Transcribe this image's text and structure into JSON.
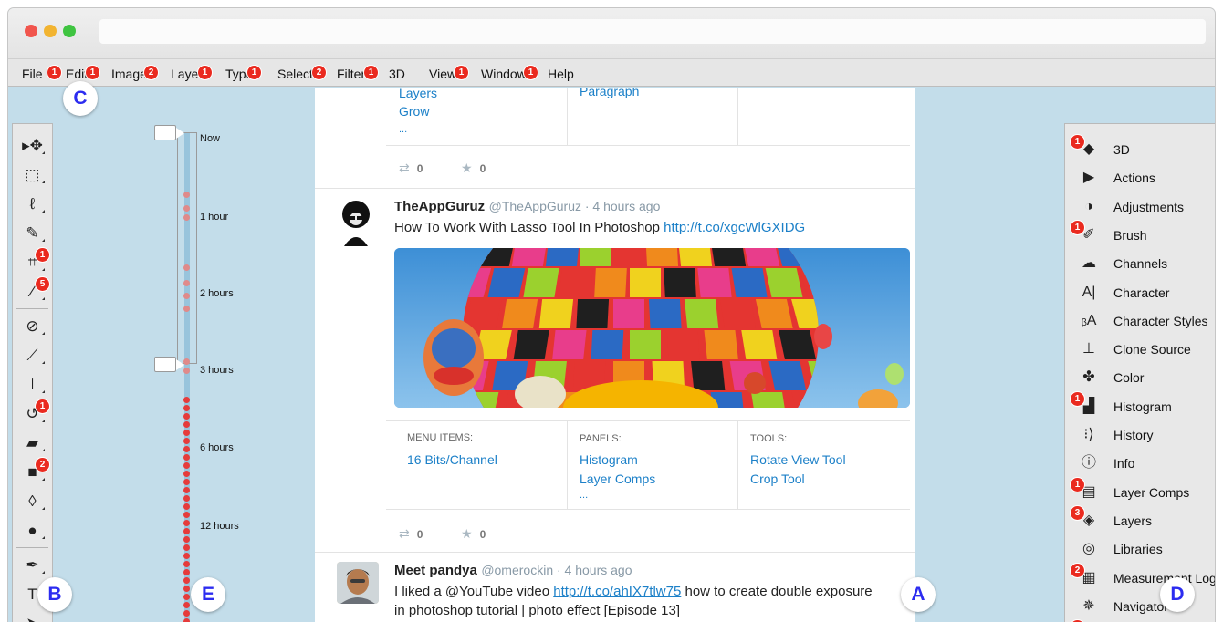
{
  "menubar": {
    "items": [
      {
        "label": "File",
        "badge": "1"
      },
      {
        "label": "Edit",
        "badge": "1"
      },
      {
        "label": "Image",
        "badge": "2"
      },
      {
        "label": "Layer",
        "badge": "1"
      },
      {
        "label": "Type",
        "badge": "1"
      },
      {
        "label": "Select",
        "badge": "2"
      },
      {
        "label": "Filter",
        "badge": "1"
      },
      {
        "label": "3D",
        "badge": ""
      },
      {
        "label": "View",
        "badge": "1"
      },
      {
        "label": "Window",
        "badge": "1"
      },
      {
        "label": "Help",
        "badge": ""
      }
    ]
  },
  "callouts": {
    "a": "A",
    "b": "B",
    "c": "C",
    "d": "D",
    "e": "E"
  },
  "toolbox": {
    "tools": [
      {
        "icon": "move-icon",
        "glyph": "▸✥",
        "badge": ""
      },
      {
        "icon": "marquee-icon",
        "glyph": "⬚",
        "badge": ""
      },
      {
        "icon": "lasso-icon",
        "glyph": "ℓ",
        "badge": ""
      },
      {
        "icon": "quick-select-icon",
        "glyph": "✎",
        "badge": ""
      },
      {
        "icon": "crop-icon",
        "glyph": "⌗",
        "badge": "1"
      },
      {
        "icon": "eyedropper-icon",
        "glyph": "⁄",
        "badge": "5"
      },
      {
        "icon": "healing-brush-icon",
        "glyph": "⊘",
        "badge": ""
      },
      {
        "icon": "brush-icon",
        "glyph": "⟋",
        "badge": ""
      },
      {
        "icon": "stamp-icon",
        "glyph": "⊥",
        "badge": ""
      },
      {
        "icon": "history-brush-icon",
        "glyph": "↺",
        "badge": "1"
      },
      {
        "icon": "eraser-icon",
        "glyph": "▰",
        "badge": ""
      },
      {
        "icon": "gradient-icon",
        "glyph": "■",
        "badge": "2"
      },
      {
        "icon": "blur-icon",
        "glyph": "◊",
        "badge": ""
      },
      {
        "icon": "dodge-icon",
        "glyph": "●",
        "badge": ""
      },
      {
        "icon": "pen-icon",
        "glyph": "✒",
        "badge": ""
      },
      {
        "icon": "type-icon",
        "glyph": "T",
        "badge": ""
      },
      {
        "icon": "path-select-icon",
        "glyph": "➤",
        "badge": ""
      }
    ]
  },
  "timeline": {
    "labels": [
      "Now",
      "1 hour",
      "2 hours",
      "3 hours",
      "6 hours",
      "12 hours"
    ]
  },
  "feed": {
    "top_card": {
      "col1_links": [
        "Layers",
        "Grow",
        "..."
      ],
      "col2_links": [
        "Paragraph"
      ],
      "retweets": "0",
      "favorites": "0"
    },
    "tweet1": {
      "name": "TheAppGuruz",
      "handle_time": "@TheAppGuruz · 4 hours ago",
      "text": "How To Work With Lasso Tool In Photoshop ",
      "link": "http://t.co/xgcWlGXIDG",
      "columns": [
        {
          "header": "MENU ITEMS:",
          "links": [
            "16 Bits/Channel"
          ]
        },
        {
          "header": "PANELS:",
          "links": [
            "Histogram",
            "Layer Comps",
            "..."
          ]
        },
        {
          "header": "TOOLS:",
          "links": [
            "Rotate View Tool",
            "Crop Tool"
          ]
        }
      ],
      "retweets": "0",
      "favorites": "0"
    },
    "tweet2": {
      "name": "Meet pandya",
      "handle_time": "@omerockin · 4 hours ago",
      "text_before": "I liked a @YouTube video ",
      "link": "http://t.co/ahIX7tlw75",
      "text_after_line1": " how to create double exposure",
      "text_line2": "in photoshop tutorial | photo effect [Episode 13]"
    }
  },
  "panels": {
    "items": [
      {
        "label": "3D",
        "icon": "cube-icon",
        "glyph": "◆",
        "badge": "1"
      },
      {
        "label": "Actions",
        "icon": "play-icon",
        "glyph": "▶",
        "badge": ""
      },
      {
        "label": "Adjustments",
        "icon": "adjustments-icon",
        "glyph": "◑",
        "badge": ""
      },
      {
        "label": "Brush",
        "icon": "brush-icon",
        "glyph": "✐",
        "badge": "1"
      },
      {
        "label": "Channels",
        "icon": "channels-icon",
        "glyph": "☁",
        "badge": ""
      },
      {
        "label": "Character",
        "icon": "character-icon",
        "glyph": "A|",
        "badge": ""
      },
      {
        "label": "Character Styles",
        "icon": "character-styles-icon",
        "glyph": "ᵦA",
        "badge": ""
      },
      {
        "label": "Clone Source",
        "icon": "clone-source-icon",
        "glyph": "⊥",
        "badge": ""
      },
      {
        "label": "Color",
        "icon": "palette-icon",
        "glyph": "✤",
        "badge": ""
      },
      {
        "label": "Histogram",
        "icon": "histogram-icon",
        "glyph": "▟",
        "badge": "1"
      },
      {
        "label": "History",
        "icon": "history-icon",
        "glyph": "⁝⟩",
        "badge": ""
      },
      {
        "label": "Info",
        "icon": "info-icon",
        "glyph": "ⓘ",
        "badge": ""
      },
      {
        "label": "Layer Comps",
        "icon": "layer-comps-icon",
        "glyph": "▤",
        "badge": "1"
      },
      {
        "label": "Layers",
        "icon": "layers-icon",
        "glyph": "◈",
        "badge": "3"
      },
      {
        "label": "Libraries",
        "icon": "libraries-icon",
        "glyph": "◎",
        "badge": ""
      },
      {
        "label": "Measurement Log",
        "icon": "measurement-log-icon",
        "glyph": "▦",
        "badge": "2"
      },
      {
        "label": "Navigator",
        "icon": "navigator-icon",
        "glyph": "✵",
        "badge": ""
      },
      {
        "label": "",
        "icon": "notes-icon",
        "glyph": "▪",
        "badge": "1"
      }
    ]
  },
  "colors": {
    "badge": "#ea2a1f",
    "link": "#1c80c8",
    "workspace": "#c3ddea",
    "callout_text": "#2c2cf0"
  }
}
